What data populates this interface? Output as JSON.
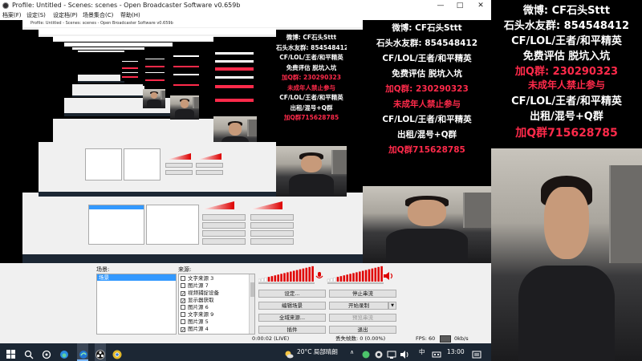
{
  "window": {
    "title": "Profile: Untitled - Scenes: scenes - Open Broadcaster Software v0.659b",
    "minimize": "—",
    "maximize": "□",
    "close": "✕"
  },
  "menu": [
    "档案(F)",
    "设定(S)",
    "设定档(P)",
    "场景集合(C)",
    "帮助(H)"
  ],
  "nested_title": "Profile: Untitled - Scenes: scenes - Open Broadcaster Software v0.659b",
  "dock": {
    "scenes_label": "场景:",
    "sources_label": "来源:",
    "scenes": [
      "场景"
    ],
    "sources": [
      {
        "label": "文字来源 3",
        "checked": false
      },
      {
        "label": "图片源 7",
        "checked": false
      },
      {
        "label": "视频捕捉设备",
        "checked": true
      },
      {
        "label": "显示器获取",
        "checked": true
      },
      {
        "label": "图片源 6",
        "checked": false
      },
      {
        "label": "文字来源 9",
        "checked": false
      },
      {
        "label": "图片源 5",
        "checked": false
      },
      {
        "label": "图片源 4",
        "checked": true
      }
    ],
    "buttons": {
      "settings": "设定...",
      "stop_stream": "停止串流",
      "edit_scene": "编辑场景",
      "start_record": "开始录制",
      "global_sources": "全域来源...",
      "preview_stream": "预览串流",
      "plugins": "插件",
      "exit": "退出"
    }
  },
  "status": {
    "time": "0:00:02 (LIVE)",
    "dropped": "丢失帧数: 0 (0.00%)",
    "fps": "FPS: 60",
    "bitrate": "0kb/s"
  },
  "taskbar": {
    "weather": "20°C  局部晴朗",
    "lang": "中",
    "clock": "13:00"
  },
  "ad": {
    "line1": "微博: CF石头Sttt",
    "line2": "石头水友群: 854548412",
    "line3": "CF/LOL/王者/和平精英",
    "line4": "免费评估 脱坑入坑",
    "line5": "加Q群: 230290323",
    "line6": "未成年人禁止参与",
    "line7": "CF/LOL/王者/和平精英",
    "line8": "出租/混号+Q群",
    "line9": "加Q群715628785"
  },
  "colors": {
    "ad_red": "#ff2a4a",
    "selection_blue": "#3399ff",
    "taskbar": "#1c2734",
    "meter_red": "#e00000"
  },
  "icons": [
    "windows-start-icon",
    "search-icon",
    "task-view-icon",
    "edge-icon",
    "obs-icon",
    "chrome-icon",
    "speaker-icon",
    "weather-icon",
    "tray-icon"
  ]
}
